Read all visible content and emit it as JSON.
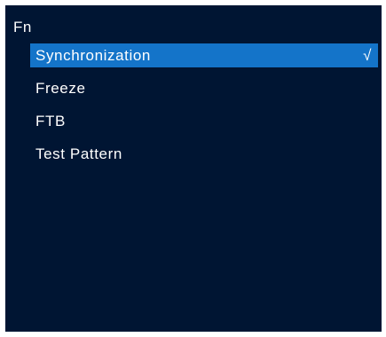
{
  "menu": {
    "title": "Fn",
    "items": [
      {
        "label": "Synchronization",
        "selected": true,
        "check": "√"
      },
      {
        "label": "Freeze",
        "selected": false
      },
      {
        "label": "FTB",
        "selected": false
      },
      {
        "label": "Test Pattern",
        "selected": false
      }
    ]
  },
  "colors": {
    "background": "#001533",
    "highlight": "#1474c9",
    "text": "#ffffff"
  },
  "icons": {
    "selected_indicator": "checkmark-icon"
  }
}
